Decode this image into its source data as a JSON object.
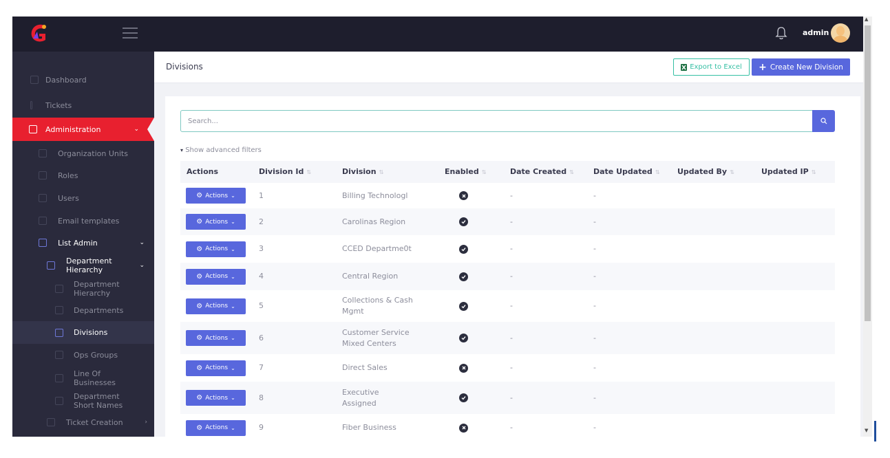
{
  "header": {
    "admin_name": "admin"
  },
  "sidebar": {
    "items": [
      {
        "label": "Dashboard"
      },
      {
        "label": "Tickets"
      },
      {
        "label": "Administration"
      },
      {
        "label": "Organization Units"
      },
      {
        "label": "Roles"
      },
      {
        "label": "Users"
      },
      {
        "label": "Email templates"
      },
      {
        "label": "List Admin"
      },
      {
        "label_line1": "Department",
        "label_line2": "Hierarchy"
      },
      {
        "label_line1": "Department",
        "label_line2": "Hierarchy"
      },
      {
        "label": "Departments"
      },
      {
        "label": "Divisions"
      },
      {
        "label": "Ops Groups"
      },
      {
        "label_line1": "Line Of",
        "label_line2": "Businesses"
      },
      {
        "label_line1": "Department",
        "label_line2": "Short Names"
      },
      {
        "label": "Ticket Creation"
      }
    ]
  },
  "page": {
    "title": "Divisions",
    "export_label": "Export to Excel",
    "create_label": "Create New Division"
  },
  "search": {
    "placeholder": "Search..."
  },
  "filters": {
    "advanced_label": "Show advanced filters"
  },
  "table": {
    "columns": [
      "Actions",
      "Division Id",
      "Division",
      "Enabled",
      "Date Created",
      "Date Updated",
      "Updated By",
      "Updated IP"
    ],
    "action_label": "Actions",
    "rows": [
      {
        "id": "1",
        "division": "Billing Technologl",
        "division2": "",
        "enabled": false,
        "created": "-",
        "updated": "-"
      },
      {
        "id": "2",
        "division": "Carolinas Region",
        "division2": "",
        "enabled": true,
        "created": "-",
        "updated": "-"
      },
      {
        "id": "3",
        "division": "CCED Departme0t",
        "division2": "",
        "enabled": true,
        "created": "-",
        "updated": "-"
      },
      {
        "id": "4",
        "division": "Central Region",
        "division2": "",
        "enabled": true,
        "created": "-",
        "updated": "-"
      },
      {
        "id": "5",
        "division": "Collections & Cash",
        "division2": "Mgmt",
        "enabled": true,
        "created": "-",
        "updated": "-"
      },
      {
        "id": "6",
        "division": "Customer Service",
        "division2": "Mixed Centers",
        "enabled": true,
        "created": "-",
        "updated": "-"
      },
      {
        "id": "7",
        "division": "Direct Sales",
        "division2": "",
        "enabled": false,
        "created": "-",
        "updated": "-"
      },
      {
        "id": "8",
        "division": "Executive",
        "division2": "Assigned",
        "enabled": true,
        "created": "-",
        "updated": "-"
      },
      {
        "id": "9",
        "division": "Fiber Business",
        "division2": "",
        "enabled": false,
        "created": "-",
        "updated": "-"
      }
    ]
  },
  "colors": {
    "accent": "#5867dd",
    "brand_red": "#e8202f",
    "sidebar_bg": "#2a2a3c",
    "topbar_bg": "#1e1e2d",
    "export_green": "#34bfa3"
  }
}
